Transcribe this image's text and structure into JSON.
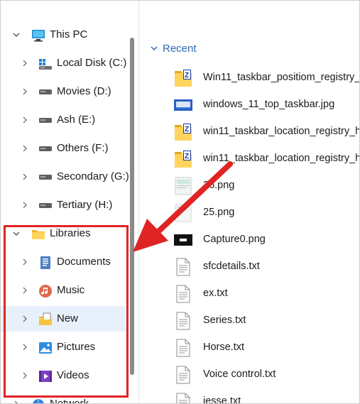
{
  "nav": {
    "items": [
      {
        "label": "This PC",
        "icon": "pc-icon",
        "expanded": true
      },
      {
        "label": "Local Disk (C:)",
        "icon": "windows-drive-icon",
        "expanded": false
      },
      {
        "label": "Movies (D:)",
        "icon": "drive-icon",
        "expanded": false
      },
      {
        "label": "Ash (E:)",
        "icon": "drive-icon",
        "expanded": false
      },
      {
        "label": "Others (F:)",
        "icon": "drive-icon",
        "expanded": false
      },
      {
        "label": "Secondary (G:)",
        "icon": "drive-icon",
        "expanded": false
      },
      {
        "label": "Tertiary (H:)",
        "icon": "drive-icon",
        "expanded": false
      },
      {
        "label": "Libraries",
        "icon": "folder-icon",
        "expanded": true
      },
      {
        "label": "Documents",
        "icon": "documents-icon",
        "expanded": false
      },
      {
        "label": "Music",
        "icon": "music-icon",
        "expanded": false
      },
      {
        "label": "New",
        "icon": "new-library-icon",
        "expanded": false,
        "selected": true
      },
      {
        "label": "Pictures",
        "icon": "pictures-icon",
        "expanded": false
      },
      {
        "label": "Videos",
        "icon": "videos-icon",
        "expanded": false
      },
      {
        "label": "Network",
        "icon": "network-icon",
        "expanded": false
      }
    ]
  },
  "main": {
    "section_label": "Recent",
    "files": [
      {
        "name": "Win11_taskbar_positiom_registry_",
        "icon": "registry-file-icon"
      },
      {
        "name": "windows_11_top_taskbar.jpg",
        "icon": "image-thumb-icon"
      },
      {
        "name": "win11_taskbar_location_registry_h",
        "icon": "registry-file-icon"
      },
      {
        "name": "win11_taskbar_location_registry_h",
        "icon": "registry-file-icon"
      },
      {
        "name": "26.png",
        "icon": "image-thumb-icon"
      },
      {
        "name": "25.png",
        "icon": "image-thumb-icon"
      },
      {
        "name": "Capture0.png",
        "icon": "image-thumb-icon"
      },
      {
        "name": "sfcdetails.txt",
        "icon": "text-file-icon"
      },
      {
        "name": "ex.txt",
        "icon": "text-file-icon"
      },
      {
        "name": "Series.txt",
        "icon": "text-file-icon"
      },
      {
        "name": "Horse.txt",
        "icon": "text-file-icon"
      },
      {
        "name": "Voice control.txt",
        "icon": "text-file-icon"
      },
      {
        "name": "jesse.txt",
        "icon": "text-file-icon"
      }
    ]
  },
  "colors": {
    "accent": "#2b6cb5",
    "selection": "#e8f1fb",
    "annotation": "#e02424"
  }
}
